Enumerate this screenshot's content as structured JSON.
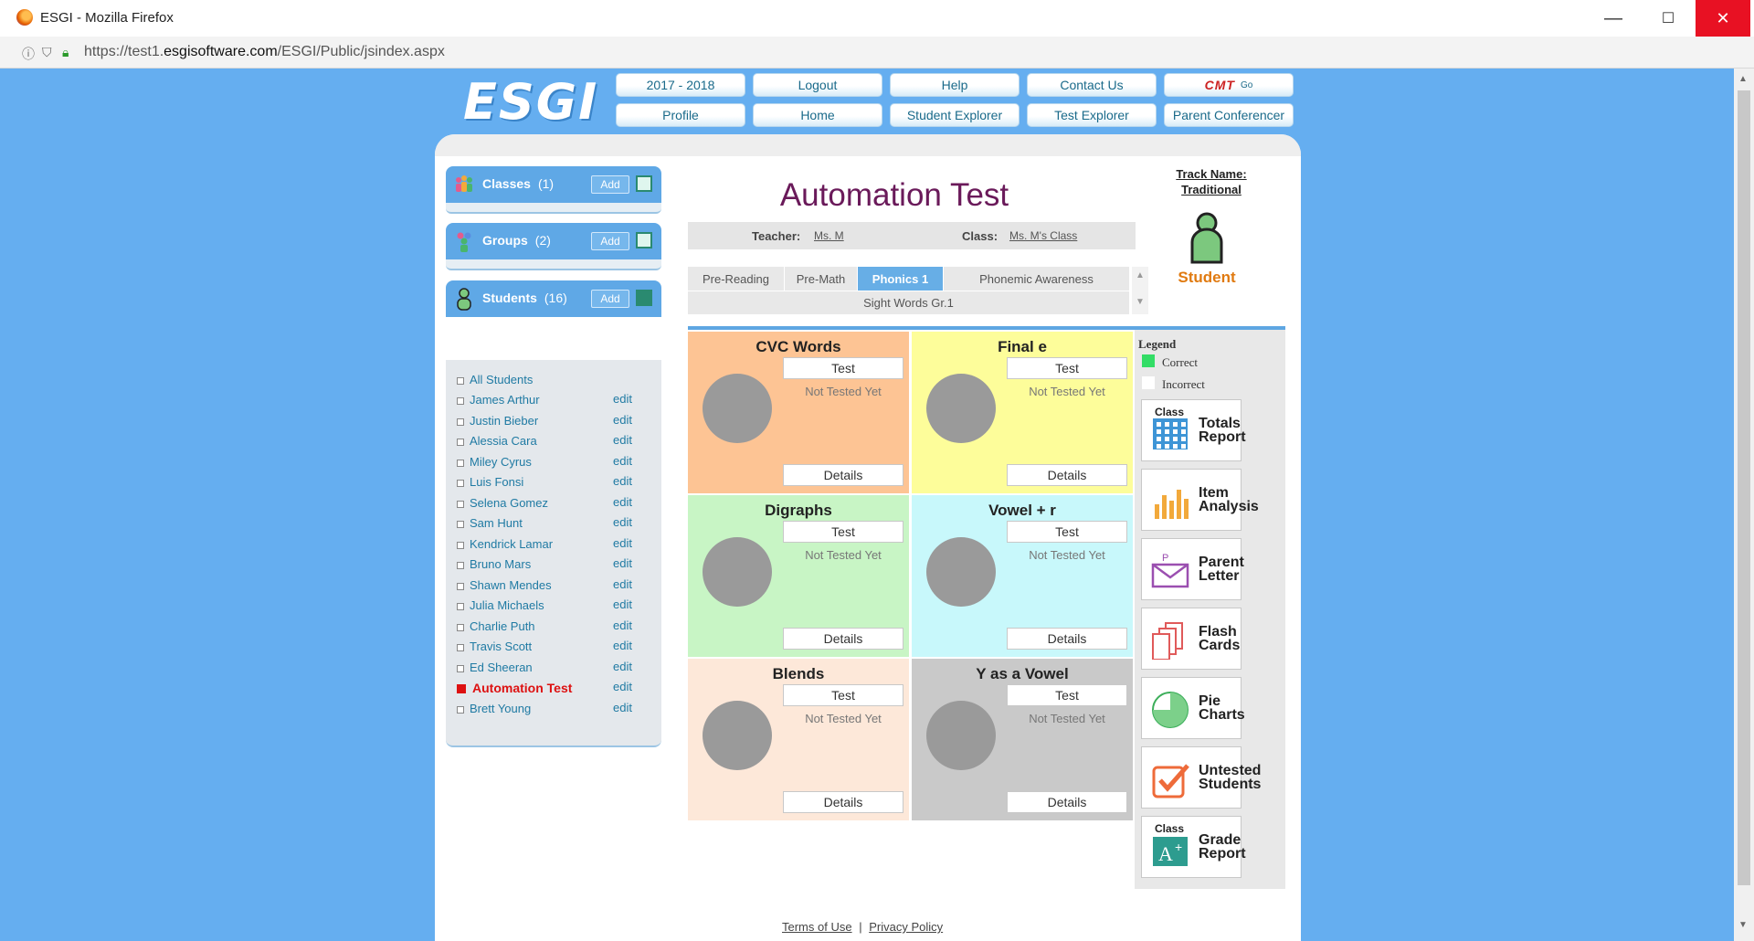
{
  "browser": {
    "window_title": "ESGI - Mozilla Firefox",
    "url_prefix": "https://test1.",
    "url_domain": "esgisoftware.com",
    "url_path": "/ESGI/Public/jsindex.aspx",
    "minimize": "—",
    "maximize": "☐",
    "close": "✕"
  },
  "logo": "ESGI",
  "nav": {
    "row1": [
      "2017 - 2018",
      "Logout",
      "Help",
      "Contact Us"
    ],
    "cmt": "CMT",
    "cmt_go": "Go",
    "row2": [
      "Profile",
      "Home",
      "Student Explorer",
      "Test Explorer",
      "Parent Conferencer"
    ]
  },
  "left": {
    "classes": {
      "label": "Classes",
      "count": "(1)",
      "add": "Add"
    },
    "groups": {
      "label": "Groups",
      "count": "(2)",
      "add": "Add"
    },
    "students": {
      "label": "Students",
      "count": "(16)",
      "add": "Add"
    },
    "all_students": "All Students",
    "list": [
      {
        "name": "James Arthur",
        "edit": "edit"
      },
      {
        "name": "Justin Bieber",
        "edit": "edit"
      },
      {
        "name": "Alessia Cara",
        "edit": "edit"
      },
      {
        "name": "Miley Cyrus",
        "edit": "edit"
      },
      {
        "name": "Luis Fonsi",
        "edit": "edit"
      },
      {
        "name": "Selena Gomez",
        "edit": "edit"
      },
      {
        "name": "Sam Hunt",
        "edit": "edit"
      },
      {
        "name": "Kendrick Lamar",
        "edit": "edit"
      },
      {
        "name": "Bruno Mars",
        "edit": "edit"
      },
      {
        "name": "Shawn Mendes",
        "edit": "edit"
      },
      {
        "name": "Julia Michaels",
        "edit": "edit"
      },
      {
        "name": "Charlie Puth",
        "edit": "edit"
      },
      {
        "name": "Travis Scott",
        "edit": "edit"
      },
      {
        "name": "Ed Sheeran",
        "edit": "edit"
      },
      {
        "name": "Automation Test",
        "edit": "edit",
        "selected": true
      },
      {
        "name": "Brett Young",
        "edit": "edit"
      }
    ]
  },
  "main": {
    "student_name": "Automation Test",
    "teacher_label": "Teacher:",
    "teacher": "Ms. M",
    "class_label": "Class:",
    "class": "Ms. M's Class",
    "tabs": [
      "Pre-Reading",
      "Pre-Math",
      "Phonics 1",
      "Phonemic Awareness"
    ],
    "active_tab": "Phonics 1",
    "tab2": "Sight Words Gr.1",
    "subtests": [
      {
        "title": "CVC Words",
        "test": "Test",
        "status": "Not Tested Yet",
        "details": "Details",
        "color": "#fdc494"
      },
      {
        "title": "Final e",
        "test": "Test",
        "status": "Not Tested Yet",
        "details": "Details",
        "color": "#fdfd9a"
      },
      {
        "title": "Digraphs",
        "test": "Test",
        "status": "Not Tested Yet",
        "details": "Details",
        "color": "#c8f5c5"
      },
      {
        "title": "Vowel + r",
        "test": "Test",
        "status": "Not Tested Yet",
        "details": "Details",
        "color": "#c8f8fb"
      },
      {
        "title": "Blends",
        "test": "Test",
        "status": "Not Tested Yet",
        "details": "Details",
        "color": "#fde8d9"
      },
      {
        "title": "Y as a Vowel",
        "test": "Test",
        "status": "Not Tested Yet",
        "details": "Details",
        "color": "#c9c9c9"
      }
    ]
  },
  "right": {
    "track_label": "Track Name:",
    "track_value": "Traditional",
    "student_label": "Student",
    "legend": {
      "title": "Legend",
      "correct": "Correct",
      "incorrect": "Incorrect",
      "correct_color": "#33dd66"
    },
    "reports": [
      {
        "small": "Class",
        "line1": "Totals",
        "line2": "Report",
        "icon": "calculator-icon"
      },
      {
        "small": "",
        "line1": "Item",
        "line2": "Analysis",
        "icon": "bar-chart-icon"
      },
      {
        "small": "",
        "line1": "Parent",
        "line2": "Letter",
        "icon": "letter-icon"
      },
      {
        "small": "",
        "line1": "Flash",
        "line2": "Cards",
        "icon": "flashcards-icon"
      },
      {
        "small": "",
        "line1": "Pie",
        "line2": "Charts",
        "icon": "pie-chart-icon"
      },
      {
        "small": "",
        "line1": "Untested",
        "line2": "Students",
        "icon": "checkbox-icon"
      },
      {
        "small": "Class",
        "line1": "Grade",
        "line2": "Report",
        "icon": "grade-icon"
      }
    ]
  },
  "footer": {
    "terms": "Terms of Use",
    "sep": "|",
    "privacy": "Privacy Policy"
  }
}
